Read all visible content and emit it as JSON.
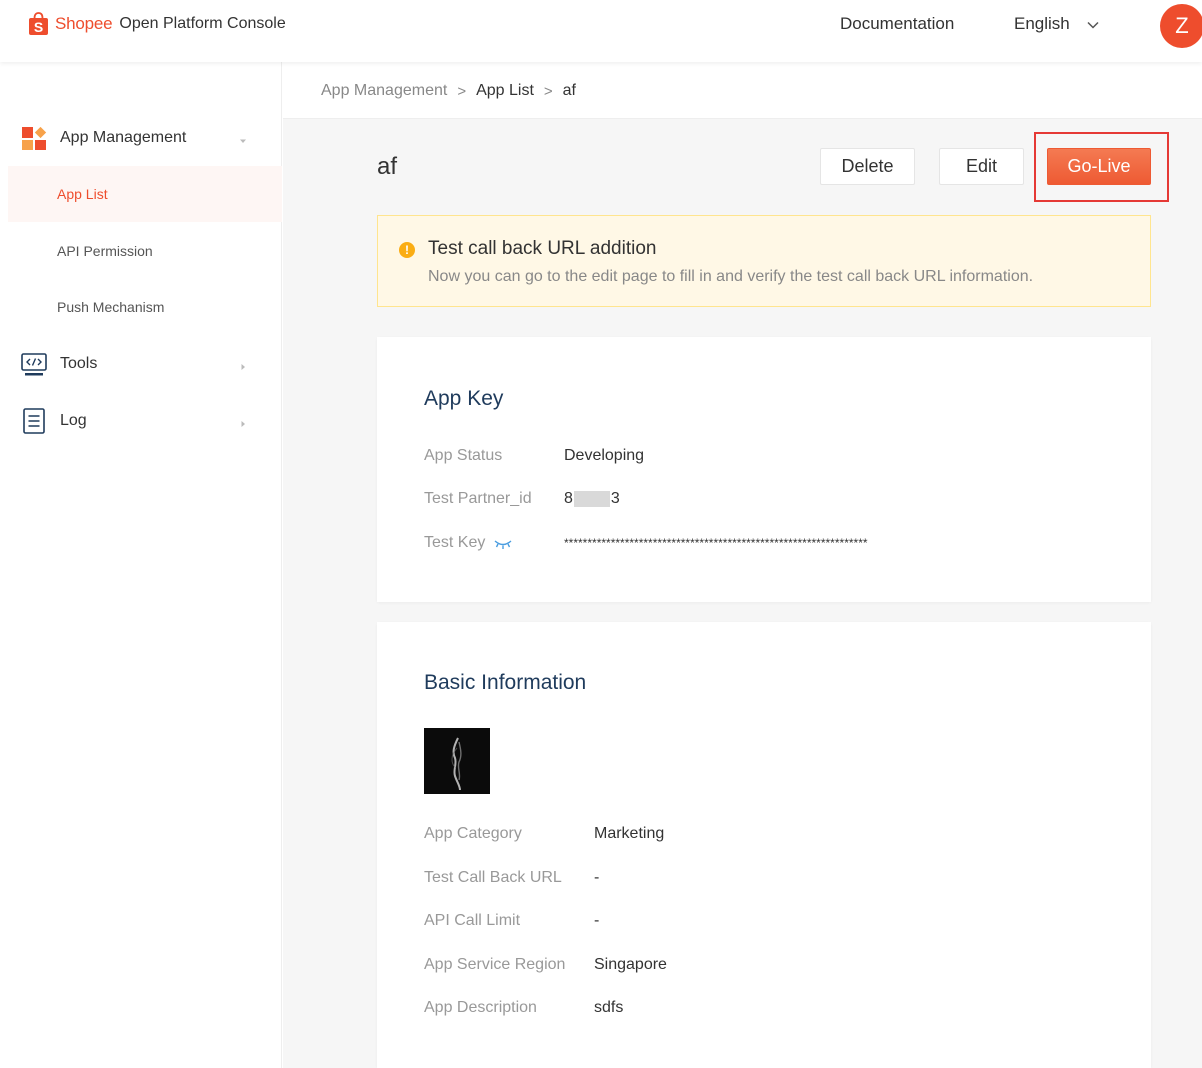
{
  "header": {
    "brand": "Shopee",
    "console_title": "Open Platform Console",
    "documentation": "Documentation",
    "language": "English",
    "avatar_letter": "Z"
  },
  "sidebar": {
    "app_management": "App Management",
    "app_list": "App List",
    "api_permission": "API Permission",
    "push_mechanism": "Push Mechanism",
    "tools": "Tools",
    "log": "Log"
  },
  "breadcrumb": {
    "root": "App Management",
    "parent": "App List",
    "current": "af",
    "separator": ">"
  },
  "page": {
    "title": "af",
    "delete_label": "Delete",
    "edit_label": "Edit",
    "golive_label": "Go-Live"
  },
  "alert": {
    "title": "Test call back URL addition",
    "description": "Now you can go to the edit page to fill in and verify the test call back URL information."
  },
  "app_key": {
    "heading": "App Key",
    "status_label": "App Status",
    "status_value": "Developing",
    "partner_label": "Test Partner_id",
    "partner_value_start": "8",
    "partner_value_end": "3",
    "key_label": "Test Key",
    "key_value": "*****************************************************************"
  },
  "basic_info": {
    "heading": "Basic Information",
    "category_label": "App Category",
    "category_value": "Marketing",
    "callback_label": "Test Call Back URL",
    "callback_value": "-",
    "limit_label": "API Call Limit",
    "limit_value": "-",
    "region_label": "App Service Region",
    "region_value": "Singapore",
    "description_label": "App Description",
    "description_value": "sdfs"
  },
  "colors": {
    "brand_orange": "#ee4d2d",
    "alert_bg": "#fff8e6",
    "highlight_frame": "#e53935"
  },
  "icons": [
    "shopee-bag-icon",
    "chevron-down-icon",
    "app-grid-icon",
    "code-monitor-icon",
    "document-icon",
    "caret-right-icon",
    "warning-icon",
    "eye-closed-icon"
  ]
}
